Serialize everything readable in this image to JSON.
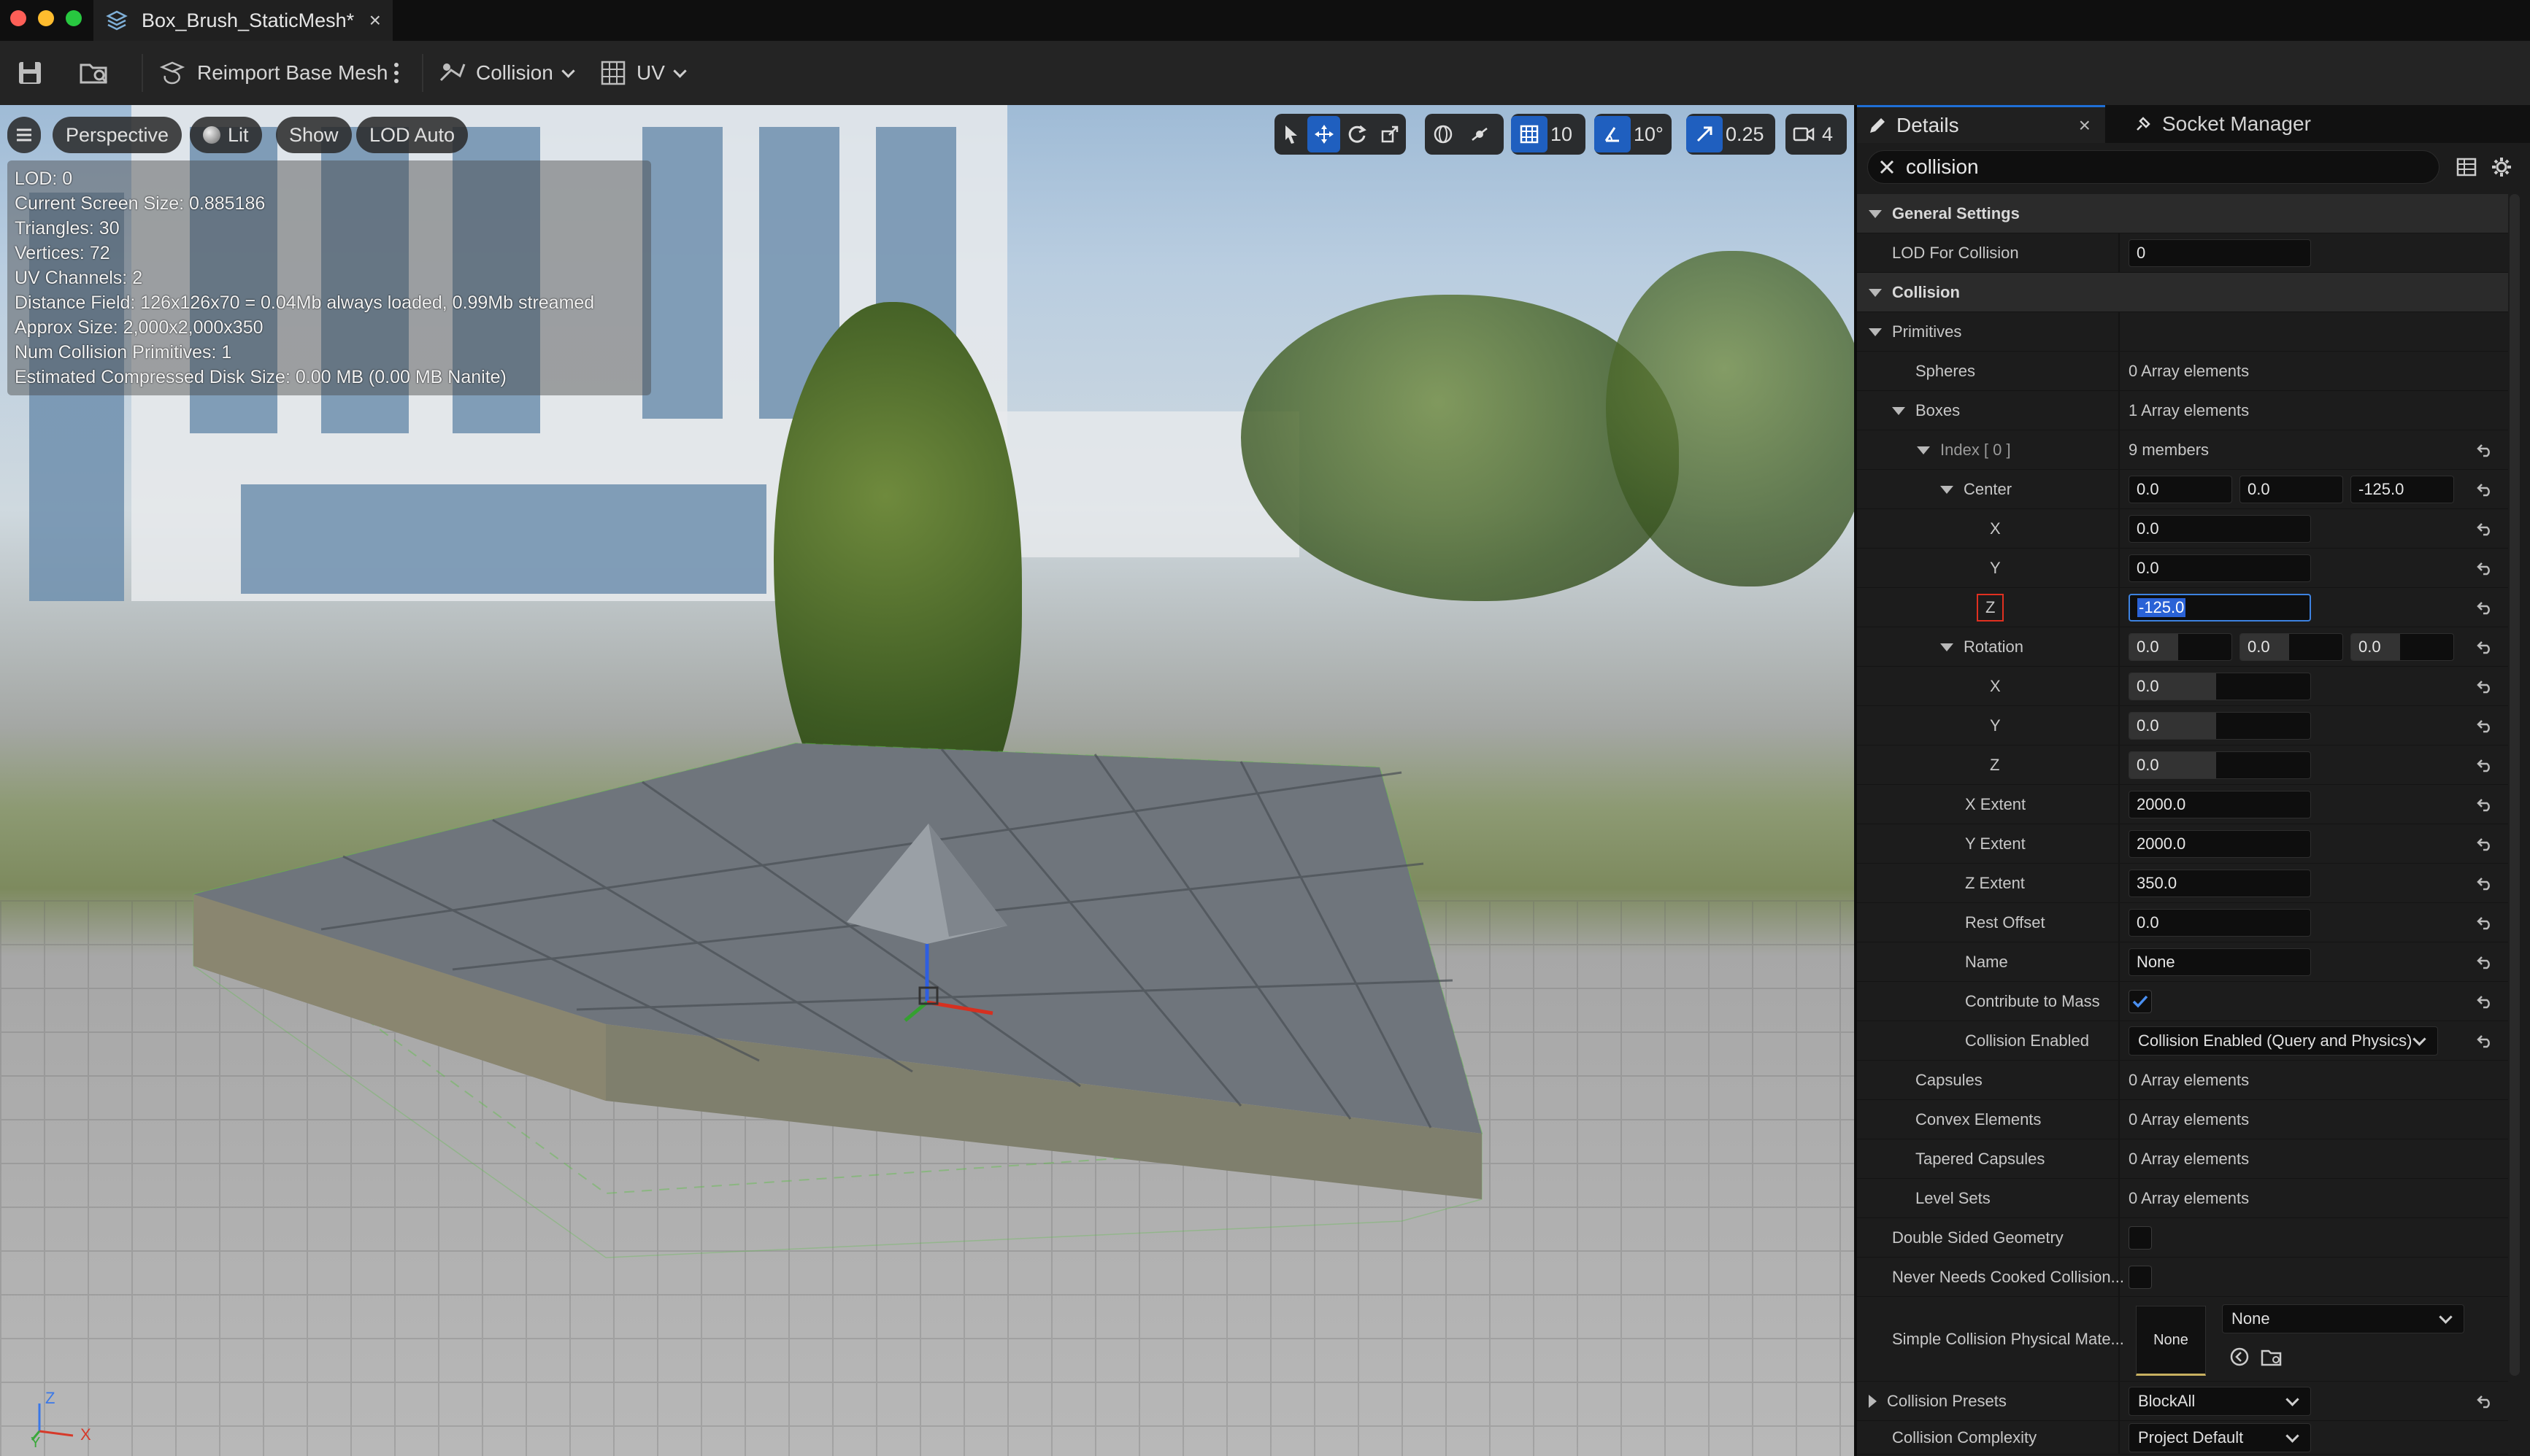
{
  "window": {
    "tab_title": "Box_Brush_StaticMesh*",
    "tab_close": "×"
  },
  "toolbar": {
    "reimport_label": "Reimport Base Mesh",
    "collision_label": "Collision",
    "uv_label": "UV"
  },
  "viewport": {
    "perspective_label": "Perspective",
    "lit_label": "Lit",
    "show_label": "Show",
    "lod_label": "LOD Auto",
    "grid_snap": "10",
    "rotation_snap": "10°",
    "scale_snap": "0.25",
    "camera_speed": "4",
    "stats": [
      "LOD:  0",
      "Current Screen Size:  0.885186",
      "Triangles:  30",
      "Vertices:  72",
      "UV Channels:  2",
      "Distance Field:  126x126x70 = 0.04Mb always loaded, 0.99Mb streamed",
      "Approx Size: 2,000x2,000x350",
      "Num Collision Primitives:  1",
      "Estimated Compressed Disk Size: 0.00 MB (0.00 MB Nanite)"
    ],
    "axis_labels": {
      "z": "Z",
      "y": "Y",
      "x": "X"
    }
  },
  "panel": {
    "details_tab": "Details",
    "details_close": "×",
    "socket_tab": "Socket Manager",
    "search_value": "collision",
    "rows": {
      "general_settings": "General Settings",
      "lod_for_collision": {
        "name": "LOD For Collision",
        "value": "0"
      },
      "collision": "Collision",
      "primitives": "Primitives",
      "spheres": {
        "name": "Spheres",
        "value": "0 Array elements"
      },
      "boxes": {
        "name": "Boxes",
        "value": "1 Array elements"
      },
      "index0": {
        "name": "Index [ 0 ]",
        "value": "9 members"
      },
      "center": {
        "name": "Center",
        "x": "0.0",
        "y": "0.0",
        "z": "-125.0"
      },
      "center_x": {
        "name": "X",
        "value": "0.0"
      },
      "center_y": {
        "name": "Y",
        "value": "0.0"
      },
      "center_z": {
        "name": "Z",
        "value": "-125.0"
      },
      "rotation": {
        "name": "Rotation",
        "x": "0.0",
        "y": "0.0",
        "z": "0.0"
      },
      "rot_x": {
        "name": "X",
        "value": "0.0"
      },
      "rot_y": {
        "name": "Y",
        "value": "0.0"
      },
      "rot_z": {
        "name": "Z",
        "value": "0.0"
      },
      "x_extent": {
        "name": "X Extent",
        "value": "2000.0"
      },
      "y_extent": {
        "name": "Y Extent",
        "value": "2000.0"
      },
      "z_extent": {
        "name": "Z Extent",
        "value": "350.0"
      },
      "rest_offset": {
        "name": "Rest Offset",
        "value": "0.0"
      },
      "elem_name": {
        "name": "Name",
        "value": "None"
      },
      "contribute_to_mass": {
        "name": "Contribute to Mass",
        "checked": true
      },
      "collision_enabled": {
        "name": "Collision Enabled",
        "value": "Collision Enabled (Query and Physics)"
      },
      "capsules": {
        "name": "Capsules",
        "value": "0 Array elements"
      },
      "convex": {
        "name": "Convex Elements",
        "value": "0 Array elements"
      },
      "tapered": {
        "name": "Tapered Capsules",
        "value": "0 Array elements"
      },
      "level_sets": {
        "name": "Level Sets",
        "value": "0 Array elements"
      },
      "double_sided": {
        "name": "Double Sided Geometry",
        "checked": false
      },
      "never_cooked": {
        "name": "Never Needs Cooked Collision...",
        "checked": false
      },
      "phys_mat": {
        "name": "Simple Collision Physical Mate...",
        "thumb": "None",
        "value": "None"
      },
      "presets": {
        "name": "Collision Presets",
        "value": "BlockAll"
      },
      "complexity": {
        "name": "Collision Complexity",
        "value": "Project Default"
      }
    }
  },
  "colors": {
    "accent": "#1f6fd6",
    "highlight_box": "#e03020",
    "checkbox_check": "#3d82e0"
  }
}
